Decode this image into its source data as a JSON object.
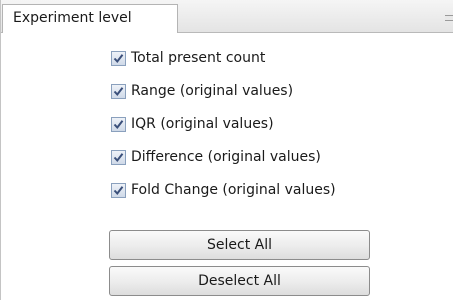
{
  "tab": {
    "label": "Experiment level"
  },
  "options": [
    {
      "label": "Total present count",
      "checked": true
    },
    {
      "label": "Range (original values)",
      "checked": true
    },
    {
      "label": "IQR (original values)",
      "checked": true
    },
    {
      "label": "Difference (original values)",
      "checked": true
    },
    {
      "label": "Fold Change (original values)",
      "checked": true
    }
  ],
  "buttons": {
    "select_all": "Select All",
    "deselect_all": "Deselect All"
  },
  "icons": {
    "checkmark": "checkmark-icon",
    "minimize": "minimize-icon"
  },
  "colors": {
    "checkmark": "#3a4f7a",
    "checkbox_border": "#8aa0bd"
  }
}
